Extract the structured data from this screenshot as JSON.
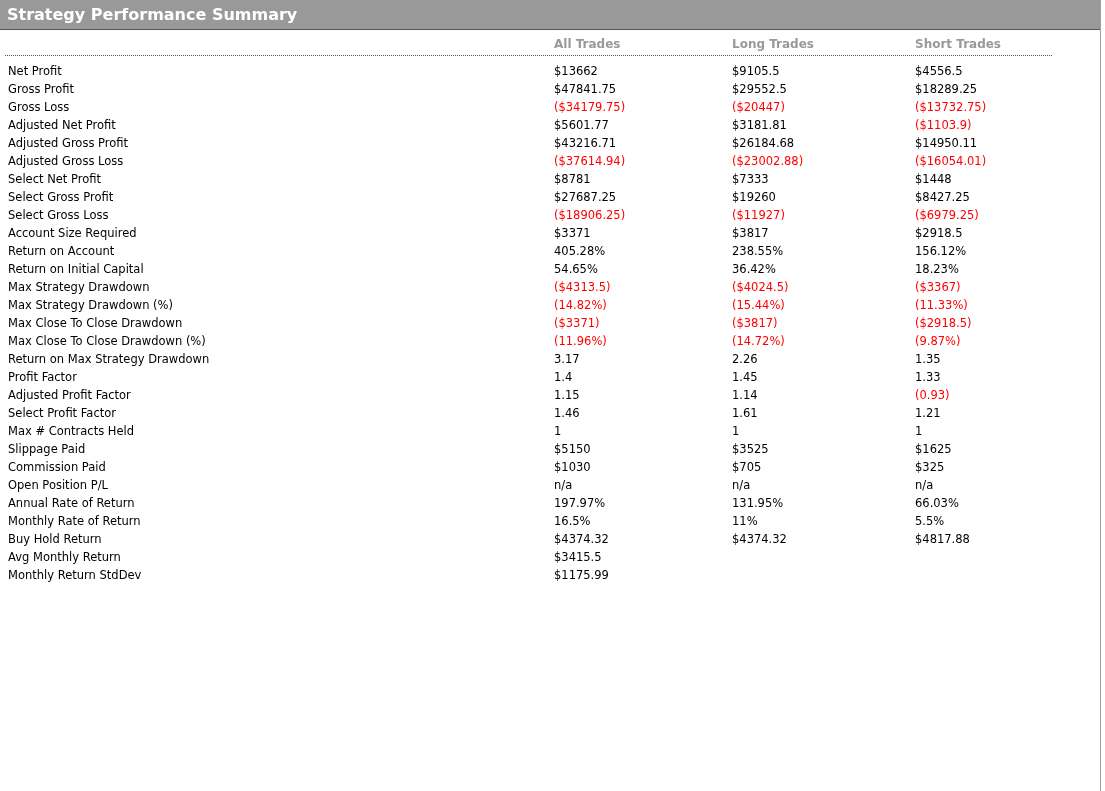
{
  "title": "Strategy Performance Summary",
  "columns": [
    "All Trades",
    "Long Trades",
    "Short Trades"
  ],
  "rows": [
    {
      "label": "Net Profit",
      "cells": [
        {
          "text": "$13662",
          "negative": false
        },
        {
          "text": "$9105.5",
          "negative": false
        },
        {
          "text": "$4556.5",
          "negative": false
        }
      ]
    },
    {
      "label": "Gross Profit",
      "cells": [
        {
          "text": "$47841.75",
          "negative": false
        },
        {
          "text": "$29552.5",
          "negative": false
        },
        {
          "text": "$18289.25",
          "negative": false
        }
      ]
    },
    {
      "label": "Gross Loss",
      "cells": [
        {
          "text": "($34179.75)",
          "negative": true
        },
        {
          "text": "($20447)",
          "negative": true
        },
        {
          "text": "($13732.75)",
          "negative": true
        }
      ]
    },
    {
      "label": "Adjusted Net Profit",
      "cells": [
        {
          "text": "$5601.77",
          "negative": false
        },
        {
          "text": "$3181.81",
          "negative": false
        },
        {
          "text": "($1103.9)",
          "negative": true
        }
      ]
    },
    {
      "label": "Adjusted Gross Profit",
      "cells": [
        {
          "text": "$43216.71",
          "negative": false
        },
        {
          "text": "$26184.68",
          "negative": false
        },
        {
          "text": "$14950.11",
          "negative": false
        }
      ]
    },
    {
      "label": "Adjusted Gross Loss",
      "cells": [
        {
          "text": "($37614.94)",
          "negative": true
        },
        {
          "text": "($23002.88)",
          "negative": true
        },
        {
          "text": "($16054.01)",
          "negative": true
        }
      ]
    },
    {
      "label": "Select Net Profit",
      "cells": [
        {
          "text": "$8781",
          "negative": false
        },
        {
          "text": "$7333",
          "negative": false
        },
        {
          "text": "$1448",
          "negative": false
        }
      ]
    },
    {
      "label": "Select Gross Profit",
      "cells": [
        {
          "text": "$27687.25",
          "negative": false
        },
        {
          "text": "$19260",
          "negative": false
        },
        {
          "text": "$8427.25",
          "negative": false
        }
      ]
    },
    {
      "label": "Select Gross Loss",
      "cells": [
        {
          "text": "($18906.25)",
          "negative": true
        },
        {
          "text": "($11927)",
          "negative": true
        },
        {
          "text": "($6979.25)",
          "negative": true
        }
      ]
    },
    {
      "label": "Account Size Required",
      "cells": [
        {
          "text": "$3371",
          "negative": false
        },
        {
          "text": "$3817",
          "negative": false
        },
        {
          "text": "$2918.5",
          "negative": false
        }
      ]
    },
    {
      "label": "Return on Account",
      "cells": [
        {
          "text": "405.28%",
          "negative": false
        },
        {
          "text": "238.55%",
          "negative": false
        },
        {
          "text": "156.12%",
          "negative": false
        }
      ]
    },
    {
      "label": "Return on Initial Capital",
      "cells": [
        {
          "text": "54.65%",
          "negative": false
        },
        {
          "text": "36.42%",
          "negative": false
        },
        {
          "text": "18.23%",
          "negative": false
        }
      ]
    },
    {
      "label": "Max Strategy Drawdown",
      "cells": [
        {
          "text": "($4313.5)",
          "negative": true
        },
        {
          "text": "($4024.5)",
          "negative": true
        },
        {
          "text": "($3367)",
          "negative": true
        }
      ]
    },
    {
      "label": "Max Strategy Drawdown (%)",
      "cells": [
        {
          "text": "(14.82%)",
          "negative": true
        },
        {
          "text": "(15.44%)",
          "negative": true
        },
        {
          "text": "(11.33%)",
          "negative": true
        }
      ]
    },
    {
      "label": "Max Close To Close Drawdown",
      "cells": [
        {
          "text": "($3371)",
          "negative": true
        },
        {
          "text": "($3817)",
          "negative": true
        },
        {
          "text": "($2918.5)",
          "negative": true
        }
      ]
    },
    {
      "label": "Max Close To Close Drawdown (%)",
      "cells": [
        {
          "text": "(11.96%)",
          "negative": true
        },
        {
          "text": "(14.72%)",
          "negative": true
        },
        {
          "text": "(9.87%)",
          "negative": true
        }
      ]
    },
    {
      "label": "Return on Max Strategy Drawdown",
      "cells": [
        {
          "text": "3.17",
          "negative": false
        },
        {
          "text": "2.26",
          "negative": false
        },
        {
          "text": "1.35",
          "negative": false
        }
      ]
    },
    {
      "label": "Profit Factor",
      "cells": [
        {
          "text": "1.4",
          "negative": false
        },
        {
          "text": "1.45",
          "negative": false
        },
        {
          "text": "1.33",
          "negative": false
        }
      ]
    },
    {
      "label": "Adjusted Profit Factor",
      "cells": [
        {
          "text": "1.15",
          "negative": false
        },
        {
          "text": "1.14",
          "negative": false
        },
        {
          "text": "(0.93)",
          "negative": true
        }
      ]
    },
    {
      "label": "Select Profit Factor",
      "cells": [
        {
          "text": "1.46",
          "negative": false
        },
        {
          "text": "1.61",
          "negative": false
        },
        {
          "text": "1.21",
          "negative": false
        }
      ]
    },
    {
      "label": "Max # Contracts Held",
      "cells": [
        {
          "text": "1",
          "negative": false
        },
        {
          "text": "1",
          "negative": false
        },
        {
          "text": "1",
          "negative": false
        }
      ]
    },
    {
      "label": "Slippage Paid",
      "cells": [
        {
          "text": "$5150",
          "negative": false
        },
        {
          "text": "$3525",
          "negative": false
        },
        {
          "text": "$1625",
          "negative": false
        }
      ]
    },
    {
      "label": "Commission Paid",
      "cells": [
        {
          "text": "$1030",
          "negative": false
        },
        {
          "text": "$705",
          "negative": false
        },
        {
          "text": "$325",
          "negative": false
        }
      ]
    },
    {
      "label": "Open Position P/L",
      "cells": [
        {
          "text": "n/a",
          "negative": false
        },
        {
          "text": "n/a",
          "negative": false
        },
        {
          "text": "n/a",
          "negative": false
        }
      ]
    },
    {
      "label": "Annual Rate of Return",
      "cells": [
        {
          "text": "197.97%",
          "negative": false
        },
        {
          "text": "131.95%",
          "negative": false
        },
        {
          "text": "66.03%",
          "negative": false
        }
      ]
    },
    {
      "label": "Monthly Rate of Return",
      "cells": [
        {
          "text": "16.5%",
          "negative": false
        },
        {
          "text": "11%",
          "negative": false
        },
        {
          "text": "5.5%",
          "negative": false
        }
      ]
    },
    {
      "label": "Buy  Hold Return",
      "cells": [
        {
          "text": "$4374.32",
          "negative": false
        },
        {
          "text": "$4374.32",
          "negative": false
        },
        {
          "text": "$4817.88",
          "negative": false
        }
      ]
    },
    {
      "label": "Avg Monthly Return",
      "cells": [
        {
          "text": "$3415.5",
          "negative": false
        }
      ]
    },
    {
      "label": "Monthly Return StdDev",
      "cells": [
        {
          "text": "$1175.99",
          "negative": false
        }
      ]
    }
  ]
}
